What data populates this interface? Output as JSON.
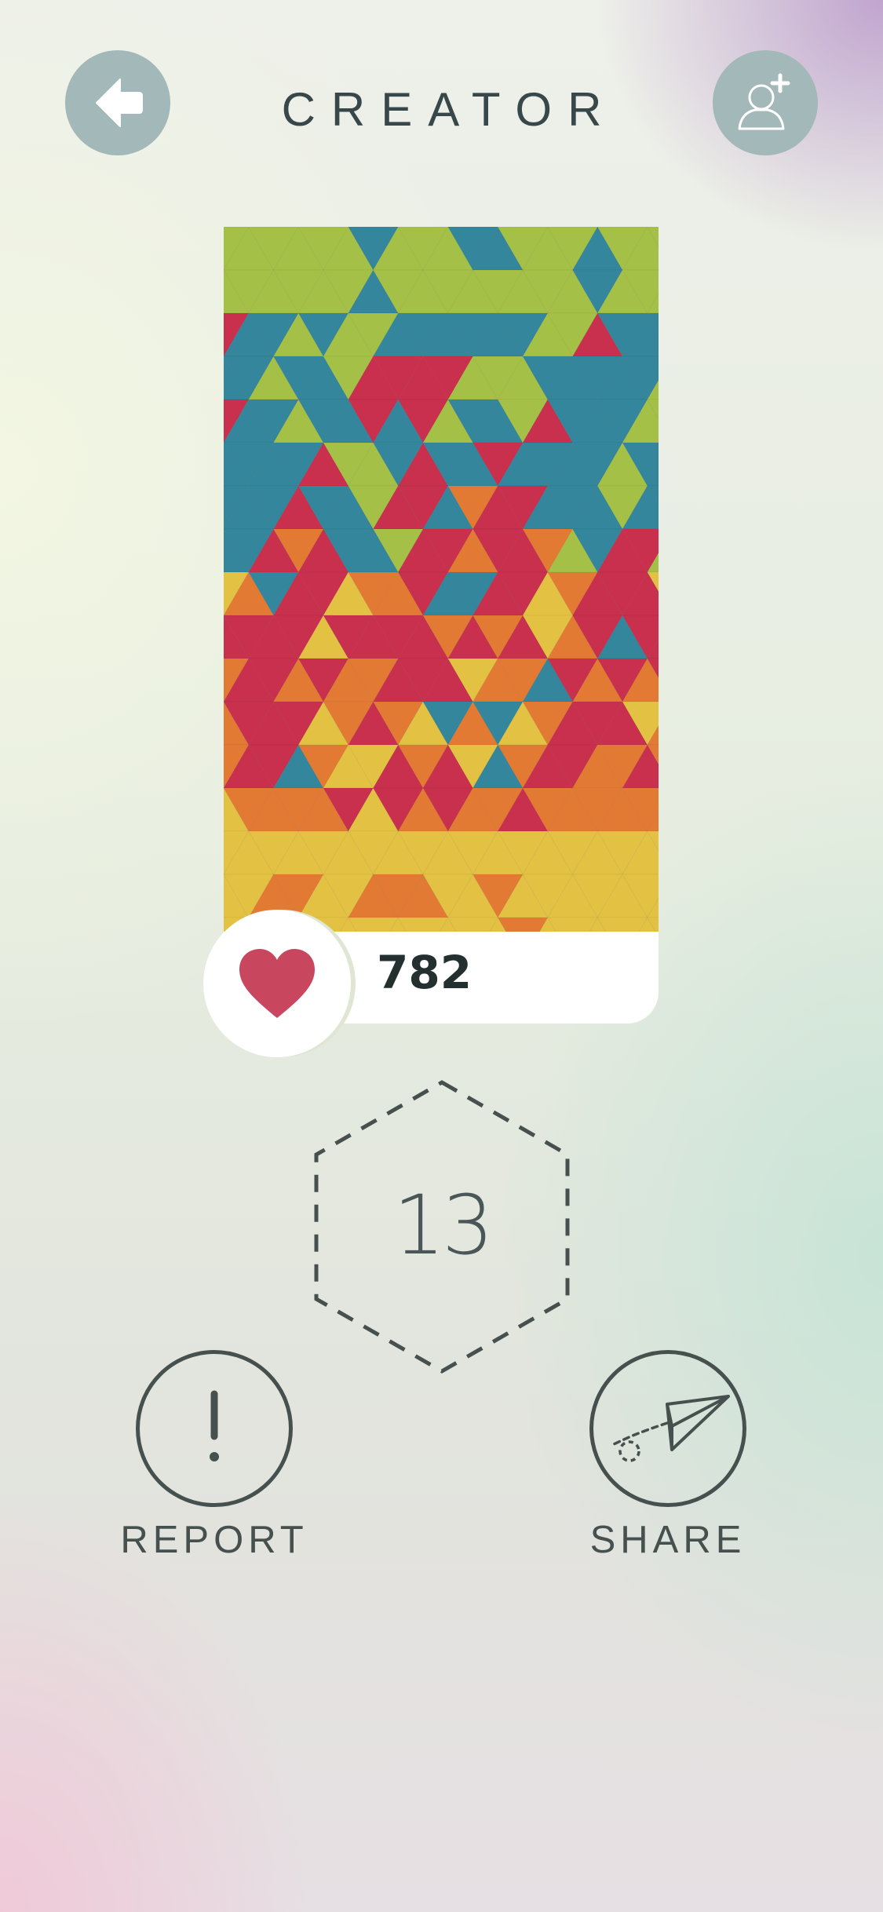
{
  "header": {
    "title": "CREATOR",
    "back_icon": "back-arrow-icon",
    "add_friend_icon": "add-user-icon"
  },
  "artwork": {
    "likes": "782",
    "heart_icon": "heart-icon",
    "colors": {
      "green": "#a5c046",
      "blue": "#33869b",
      "red": "#c8304d",
      "orange": "#e37a34",
      "yellow": "#e3c143"
    }
  },
  "level": {
    "number": "13"
  },
  "actions": {
    "report_label": "REPORT",
    "report_icon": "exclamation-icon",
    "share_label": "SHARE",
    "share_icon": "paper-plane-icon"
  },
  "colors": {
    "header_button": "#a3b8b8",
    "heart": "#c8475f",
    "text_dark": "#37474a"
  }
}
